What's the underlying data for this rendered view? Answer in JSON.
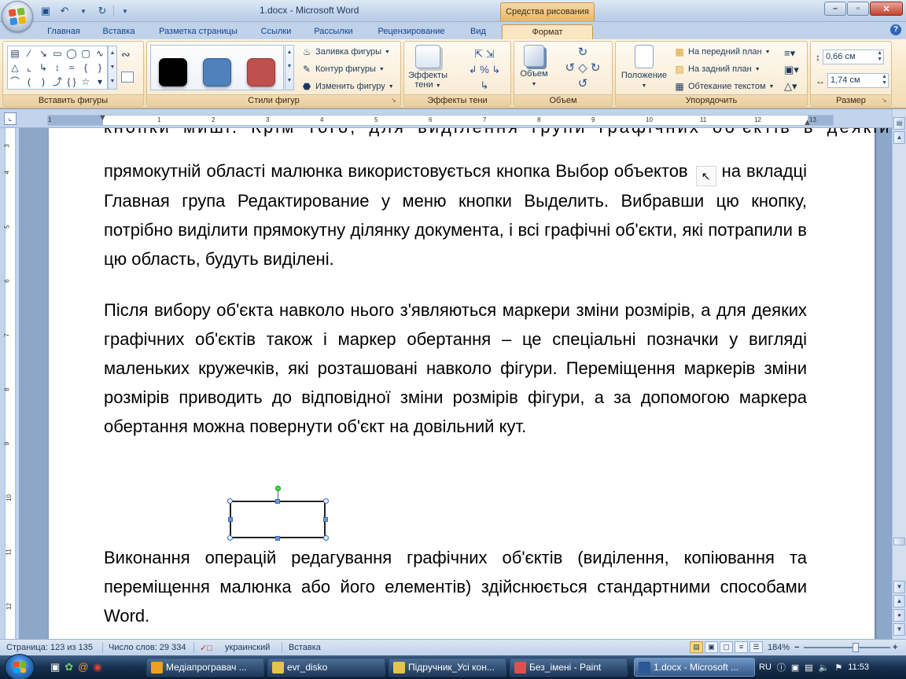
{
  "window": {
    "title": "1.docx - Microsoft Word",
    "context_tab_title": "Средства рисования",
    "controls": {
      "minimize": "–",
      "maximize": "▫",
      "close": "✕"
    }
  },
  "quick_access": {
    "save_icon": "floppy-icon",
    "undo_icon": "undo-icon",
    "redo_icon": "redo-icon",
    "customize_icon": "chevron-down-icon"
  },
  "ribbon_tabs": [
    "Главная",
    "Вставка",
    "Разметка страницы",
    "Ссылки",
    "Рассылки",
    "Рецензирование",
    "Вид",
    "Формат"
  ],
  "active_tab": "Формат",
  "groups": {
    "insert_shapes": {
      "label": "Вставить фигуры"
    },
    "shape_styles": {
      "label": "Стили фигур",
      "swatches": [
        "#000000",
        "#4f81bd",
        "#c0504d"
      ],
      "fill": "Заливка фигуры",
      "outline": "Контур фигуры",
      "change": "Изменить фигуру"
    },
    "shadow_effects": {
      "label": "Эффекты тени",
      "button": "Эффекты тени"
    },
    "volume": {
      "label": "Объем",
      "button": "Объем"
    },
    "arrange": {
      "label": "Упорядочить",
      "position": "Положение",
      "bring_front": "На передний план",
      "send_back": "На задний план",
      "wrap": "Обтекание текстом"
    },
    "size": {
      "label": "Размер",
      "height": "0,66 см",
      "width": "1,74 см"
    }
  },
  "ruler": {
    "h_numbers": [
      "1",
      "1",
      "2",
      "3",
      "4",
      "5",
      "6",
      "7",
      "8",
      "9",
      "10",
      "11",
      "12",
      "13"
    ],
    "v_numbers": [
      "3",
      "4",
      "5",
      "6",
      "7",
      "8",
      "9",
      "10",
      "11",
      "12",
      "13"
    ]
  },
  "document": {
    "cut_line": "кнопки миші. Крім того, для виділення групи графічних об'єктів в деякій",
    "p1_text": "прямокутній області малюнка використовується кнопка Выбор объектов",
    "p1_rest": "на вкладці Главная група Редактирование у меню кнопки Выделить. Вибравши цю кнопку, потрібно виділити прямокутну ділянку документа, і всі графічні об'єкти, які потрапили в цю область, будуть виділені.",
    "p2": "Після вибору об'єкта навколо нього з'являються маркери зміни розмірів, а для деяких графічних об'єктів також і маркер обертання – це спеціальні позначки у вигляді маленьких кружечків, які розташовані навколо фігури. Переміщення маркерів зміни розмірів приводить до відповідної зміни розмірів фігури, а за допомогою маркера обертання можна повернути об'єкт на довільний кут.",
    "p3": "Виконання операцій редагування графічних об'єктів (виділення, копіювання та переміщення малюнка або його елементів) здійснюється стандартними способами Word."
  },
  "status": {
    "page": "Страница: 123 из 135",
    "words": "Число слов: 29 334",
    "language": "украинский",
    "mode": "Вставка",
    "zoom": "184%"
  },
  "taskbar": {
    "tasks": [
      {
        "label": "Медіапрогравач ...",
        "color": "#f0a020"
      },
      {
        "label": "evr_disko",
        "color": "#e6c34a"
      },
      {
        "label": "Підручник_Усі кон...",
        "color": "#e6c34a"
      },
      {
        "label": "Без_імені - Paint",
        "color": "#d9534f"
      },
      {
        "label": "1.docx - Microsoft ...",
        "color": "#2b5797"
      }
    ],
    "lang": "RU",
    "time": "11:53"
  }
}
